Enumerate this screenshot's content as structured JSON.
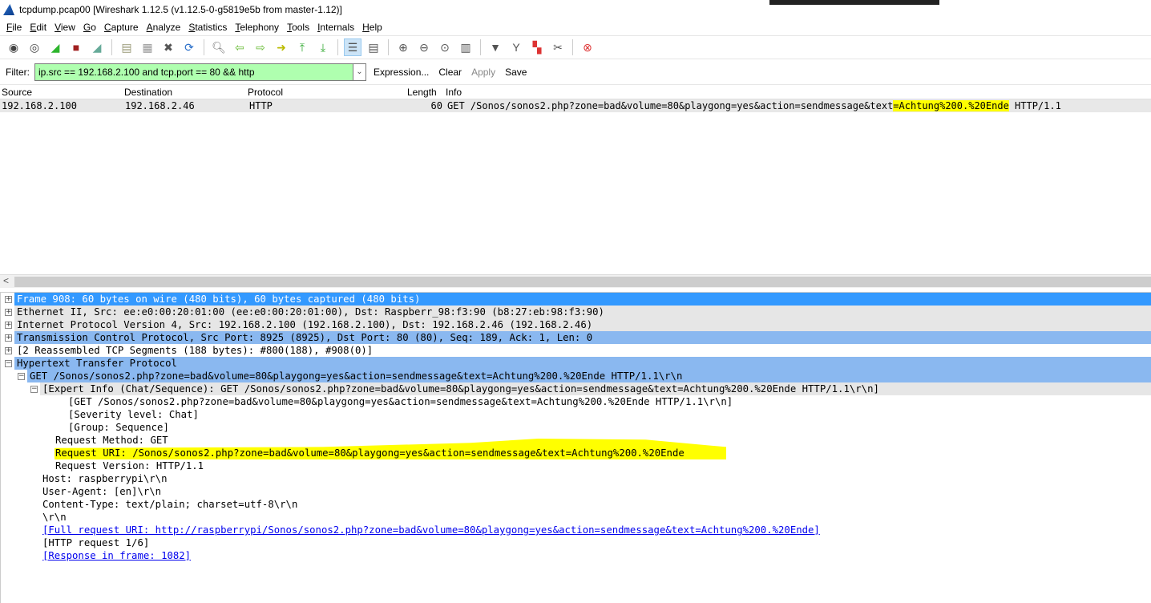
{
  "window": {
    "title": "tcpdump.pcap00  [Wireshark 1.12.5  (v1.12.5-0-g5819e5b from master-1.12)]"
  },
  "menu": [
    "File",
    "Edit",
    "View",
    "Go",
    "Capture",
    "Analyze",
    "Statistics",
    "Telephony",
    "Tools",
    "Internals",
    "Help"
  ],
  "filter": {
    "label": "Filter:",
    "value": "ip.src == 192.168.2.100 and tcp.port == 80 && http",
    "expression": "Expression...",
    "clear": "Clear",
    "apply": "Apply",
    "save": "Save",
    "color": "#afffaf"
  },
  "packet_list": {
    "columns": [
      "Source",
      "Destination",
      "Protocol",
      "Length",
      "Info"
    ],
    "rows": [
      {
        "source": "192.168.2.100",
        "destination": "192.168.2.46",
        "protocol": "HTTP",
        "length": "60",
        "info_pre": "GET /Sonos/sonos2.php?zone=bad&volume=80&playgong=yes&action=sendmessage&text",
        "info_hl": "=Achtung%200.%20Ende",
        "info_post": " HTTP/1.1"
      }
    ]
  },
  "tree": [
    {
      "text": "Frame 908: 60 bytes on wire (480 bits), 60 bytes captured (480 bits)",
      "exp": "+",
      "style": "sel"
    },
    {
      "text": "Ethernet II, Src: ee:e0:00:20:01:00 (ee:e0:00:20:01:00), Dst: Raspberr_98:f3:90 (b8:27:eb:98:f3:90)",
      "exp": "+",
      "style": "gray"
    },
    {
      "text": "Internet Protocol Version 4, Src: 192.168.2.100 (192.168.2.100), Dst: 192.168.2.46 (192.168.2.46)",
      "exp": "+",
      "style": "gray"
    },
    {
      "text": "Transmission Control Protocol, Src Port: 8925 (8925), Dst Port: 80 (80), Seq: 189, Ack: 1, Len: 0",
      "exp": "+",
      "style": "lblue"
    },
    {
      "text": "[2 Reassembled TCP Segments (188 bytes): #800(188), #908(0)]",
      "exp": "+",
      "style": ""
    },
    {
      "text": "Hypertext Transfer Protocol",
      "exp": "-",
      "style": "lblue"
    },
    {
      "text": "GET /Sonos/sonos2.php?zone=bad&volume=80&playgong=yes&action=sendmessage&text=Achtung%200.%20Ende HTTP/1.1\\r\\n",
      "exp": "-",
      "style": "lblue",
      "indent": 1
    },
    {
      "text": "[Expert Info (Chat/Sequence): GET /Sonos/sonos2.php?zone=bad&volume=80&playgong=yes&action=sendmessage&text=Achtung%200.%20Ende HTTP/1.1\\r\\n]",
      "exp": "-",
      "style": "gray",
      "indent": 2
    },
    {
      "text": "[GET /Sonos/sonos2.php?zone=bad&volume=80&playgong=yes&action=sendmessage&text=Achtung%200.%20Ende HTTP/1.1\\r\\n]",
      "indent": 4
    },
    {
      "text": "[Severity level: Chat]",
      "indent": 4
    },
    {
      "text": "[Group: Sequence]",
      "indent": 4
    },
    {
      "text": "Request Method: GET",
      "indent": 3
    },
    {
      "text": "Request URI: /Sonos/sonos2.php?zone=bad&volume=80&playgong=yes&action=sendmessage&text=Achtung%200.%20Ende",
      "indent": 3
    },
    {
      "text": "Request Version: HTTP/1.1",
      "indent": 3
    },
    {
      "text": "Host: raspberrypi\\r\\n",
      "indent": 2
    },
    {
      "text": "User-Agent: [en]\\r\\n",
      "indent": 2
    },
    {
      "text": "Content-Type: text/plain; charset=utf-8\\r\\n",
      "indent": 2
    },
    {
      "text": "\\r\\n",
      "indent": 2
    },
    {
      "text": "[Full request URI: http://raspberrypi/Sonos/sonos2.php?zone=bad&volume=80&playgong=yes&action=sendmessage&text=Achtung%200.%20Ende]",
      "indent": 2,
      "link": true
    },
    {
      "text": "[HTTP request 1/6]",
      "indent": 2
    },
    {
      "text": "[Response in frame: 1082]",
      "indent": 2,
      "link": true
    }
  ]
}
